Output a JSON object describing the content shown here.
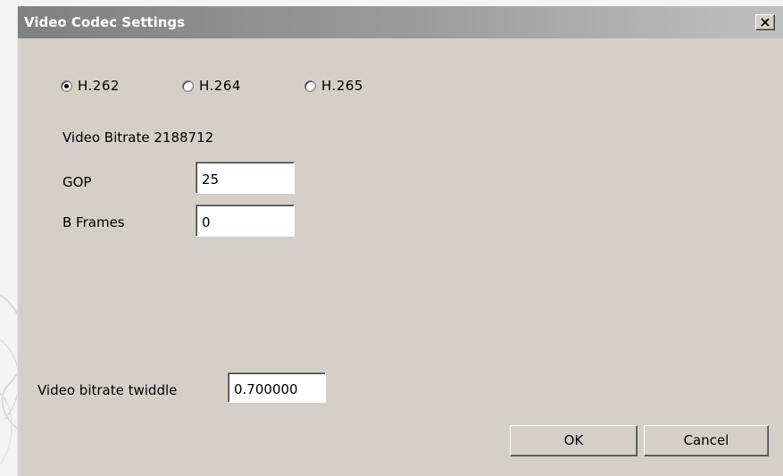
{
  "window": {
    "title": "Video Codec Settings",
    "close_label": "X"
  },
  "codec": {
    "options": [
      {
        "label": "H.262",
        "selected": true
      },
      {
        "label": "H.264",
        "selected": false
      },
      {
        "label": "H.265",
        "selected": false
      }
    ]
  },
  "video_bitrate_label": "Video Bitrate 2188712",
  "gop": {
    "label": "GOP",
    "value": "25"
  },
  "b_frames": {
    "label": "B Frames",
    "value": "0"
  },
  "twiddle": {
    "label": "Video bitrate twiddle",
    "value": "0.700000"
  },
  "buttons": {
    "ok": "OK",
    "cancel": "Cancel"
  }
}
